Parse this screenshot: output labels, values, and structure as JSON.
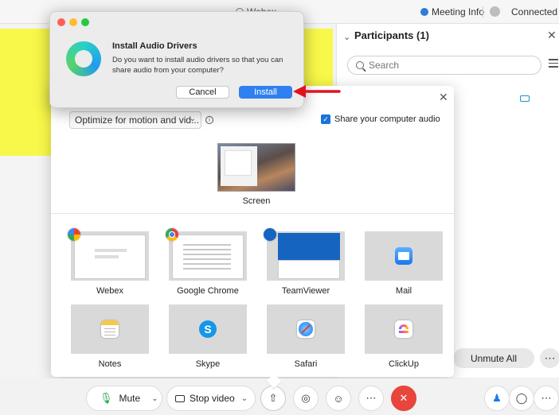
{
  "titlebar": {
    "app_title": "Webex",
    "meeting_info": "Meeting Info",
    "connection_status": "Connected"
  },
  "participants": {
    "title": "Participants (1)",
    "search_placeholder": "Search",
    "unmute_all_label": "Unmute All",
    "more_label": "⋯"
  },
  "share": {
    "optimize_value": "Optimize for motion and vid...",
    "share_audio_label": "Share your computer audio",
    "share_audio_checked": true,
    "screen_label": "Screen",
    "apps": [
      {
        "label": "Webex",
        "icon": "webex-icon"
      },
      {
        "label": "Google Chrome",
        "icon": "chrome-icon"
      },
      {
        "label": "TeamViewer",
        "icon": "teamviewer-icon"
      },
      {
        "label": "Mail",
        "icon": "mail-icon"
      },
      {
        "label": "Notes",
        "icon": "notes-icon"
      },
      {
        "label": "Skype",
        "icon": "skype-icon"
      },
      {
        "label": "Safari",
        "icon": "safari-icon"
      },
      {
        "label": "ClickUp",
        "icon": "clickup-icon"
      }
    ]
  },
  "dialog": {
    "title": "Install Audio Drivers",
    "message": "Do you want to install audio drivers so that you can share audio from your computer?",
    "cancel_label": "Cancel",
    "install_label": "Install"
  },
  "toolbar": {
    "mute_label": "Mute",
    "stop_video_label": "Stop video"
  },
  "colors": {
    "accent_blue": "#2f80f0",
    "end_call_red": "#e8453c",
    "stage_yellow": "#f8f84a",
    "arrow_red": "#e0121f"
  }
}
